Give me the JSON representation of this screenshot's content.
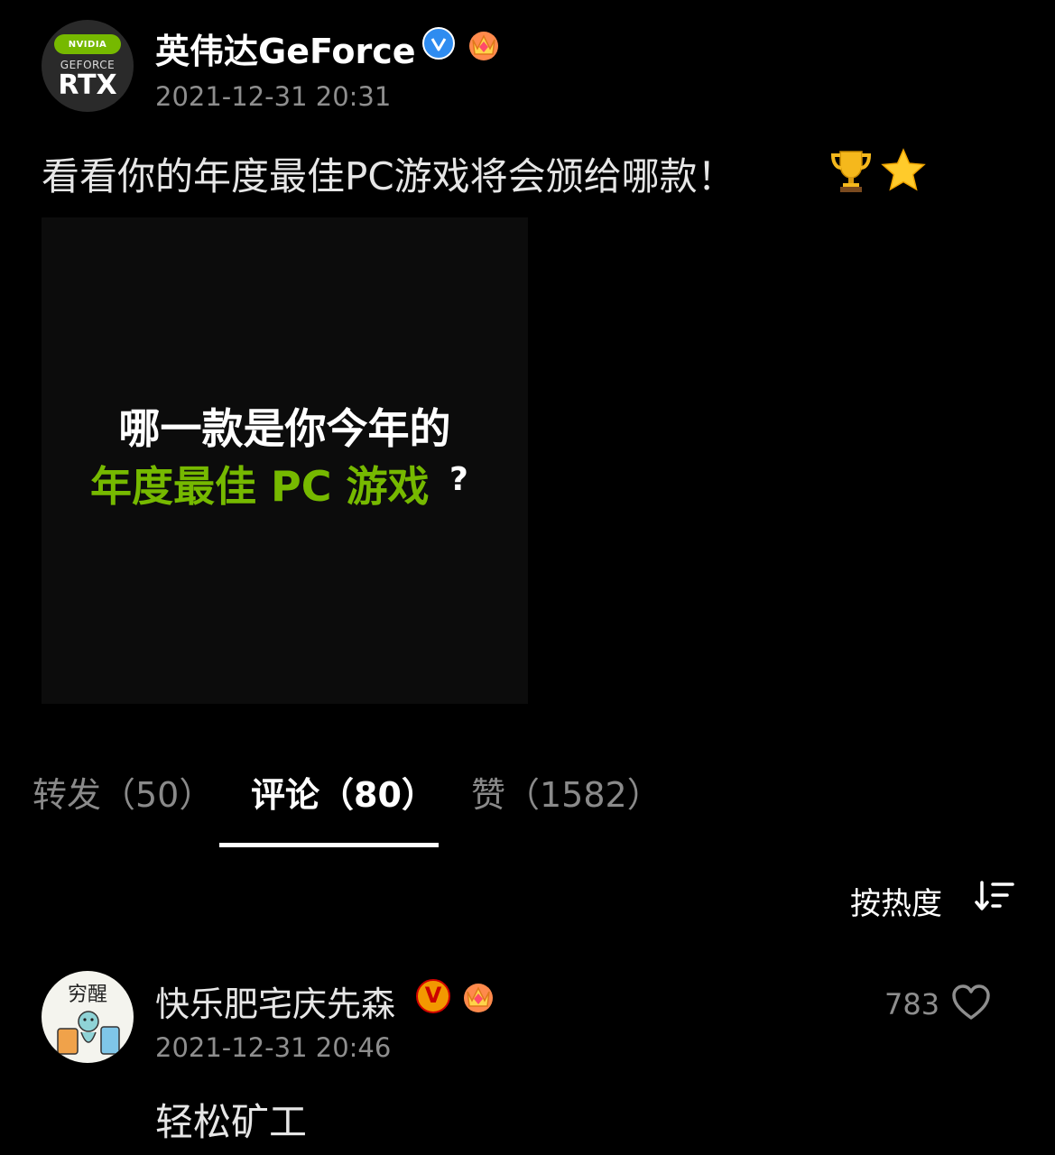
{
  "post": {
    "avatar": {
      "badge_text": "NVIDIA",
      "line1": "GEFORCE",
      "line2": "RTX"
    },
    "author": "英伟达GeForce",
    "time": "2021-12-31 20:31",
    "text": "看看你的年度最佳PC游戏将会颁给哪款！",
    "emojis": [
      "trophy-icon",
      "star-icon"
    ],
    "image": {
      "line1": "哪一款是你今年的",
      "line2": "年度最佳 PC 游戏",
      "question_mark": "?",
      "accent_color": "#76b900"
    }
  },
  "tabs": [
    {
      "label": "转发（50）",
      "active": false
    },
    {
      "label": "评论（80）",
      "active": true
    },
    {
      "label": "赞（1582）",
      "active": false
    }
  ],
  "sort": {
    "label": "按热度"
  },
  "comment": {
    "avatar_text": "穷醒",
    "name": "快乐肥宅庆先森",
    "badge": "V",
    "time": "2021-12-31 20:46",
    "likes": "783",
    "text": "轻松矿工"
  },
  "colors": {
    "background": "#000000",
    "nvidia_green": "#76b900",
    "verified_blue": "#2f8cf0",
    "verified_orange": "#f39800",
    "muted_text": "#8e8e8e"
  }
}
